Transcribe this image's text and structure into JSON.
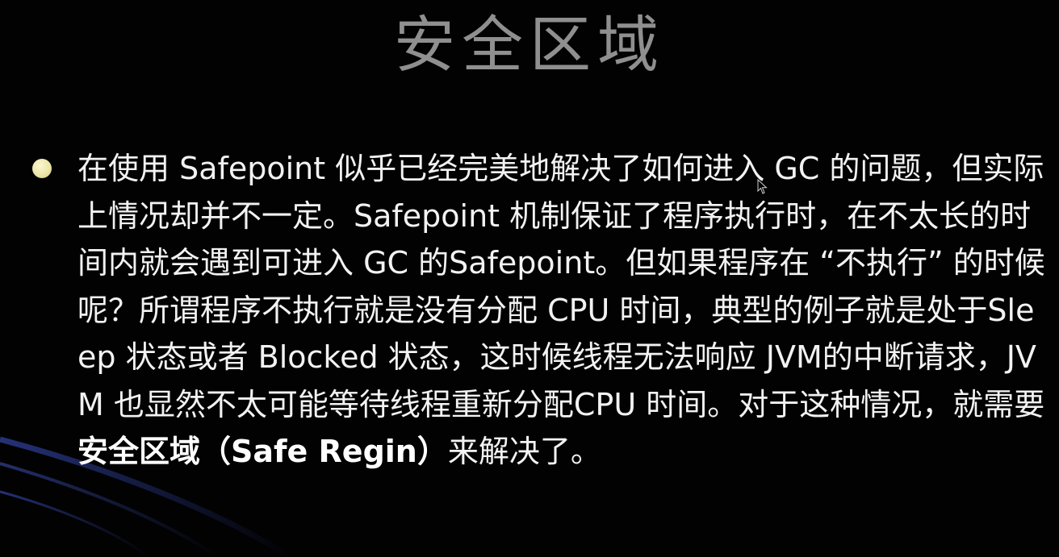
{
  "slide": {
    "title": "安全区域",
    "body": {
      "text": "在使用 Safepoint 似乎已经完美地解决了如何进入 GC 的问题，但实际上情况却并不一定。Safepoint 机制保证了程序执行时，在不太长的时间内就会遇到可进入 GC 的Safepoint。但如果程序在 “不执行” 的时候呢？所谓程序不执行就是没有分配 CPU 时间，典型的例子就是处于Sleep 状态或者 Blocked 状态，这时候线程无法响应 JVM的中断请求，JVM 也显然不太可能等待线程重新分配CPU 时间。对于这种情况，就需要",
      "emphasis": "安全区域（Safe Regin）",
      "tail": "来解决了。"
    },
    "colors": {
      "background": "#020203",
      "title": "#8f8f8f",
      "text": "#f2f2f2",
      "bullet": "#ece6a8",
      "decor": "#2b3a8c"
    },
    "icons": {
      "bullet": "bullet-dot-icon",
      "cursor": "mouse-pointer-icon"
    }
  }
}
